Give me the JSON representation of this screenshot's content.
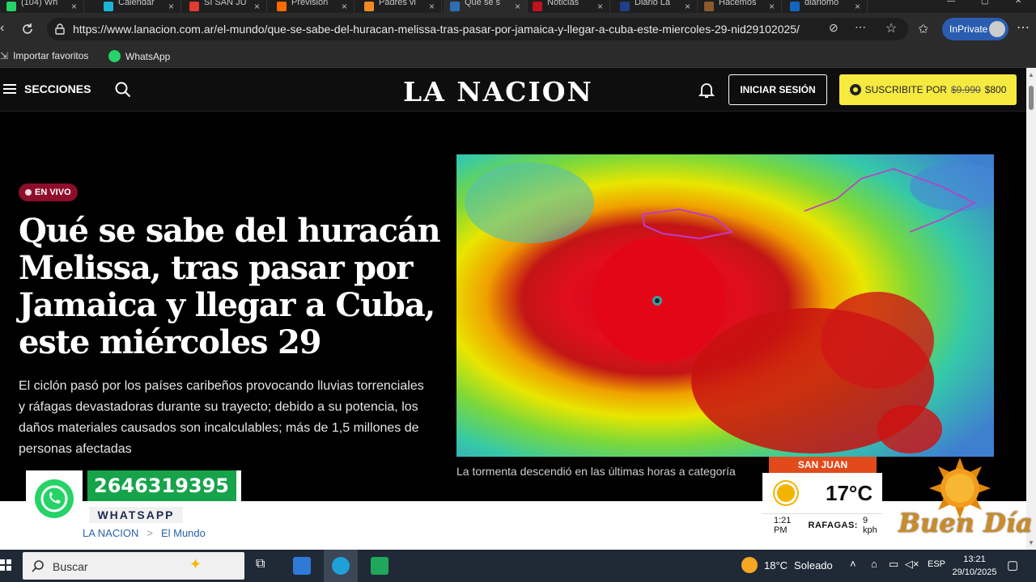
{
  "browser": {
    "tabs": [
      {
        "title": "(104) Wh",
        "favicon_color": "#25d366",
        "active": false
      },
      {
        "title": "Calendar",
        "favicon_color": "#19b3d6",
        "active": false
      },
      {
        "title": "SI SAN JU",
        "favicon_color": "#e23b2f",
        "active": false
      },
      {
        "title": "Previsión",
        "favicon_color": "#ff6a00",
        "active": false
      },
      {
        "title": "Padres vi",
        "favicon_color": "#f08a24",
        "active": false
      },
      {
        "title": "Qué se s",
        "favicon_color": "#2d6fb3",
        "active": true
      },
      {
        "title": "Noticias",
        "favicon_color": "#c1121f",
        "active": false
      },
      {
        "title": "Diario La",
        "favicon_color": "#1f3f8a",
        "active": false
      },
      {
        "title": "Hacemos",
        "favicon_color": "#8b5a2b",
        "active": false
      },
      {
        "title": "diariomo",
        "favicon_color": "#1565c0",
        "active": false
      }
    ],
    "url": "https://www.lanacion.com.ar/el-mundo/que-se-sabe-del-huracan-melissa-tras-pasar-por-jamaica-y-llegar-a-cuba-este-miercoles-29-nid29102025/",
    "inprivate_label": "InPrivate",
    "bookmarks": [
      {
        "label": "Importar favoritos",
        "icon": "import-icon"
      },
      {
        "label": "WhatsApp",
        "icon": "whatsapp-icon"
      }
    ]
  },
  "site": {
    "sections_label": "SECCIONES",
    "logo": "LA NACION",
    "login_label": "INICIAR SESIÓN",
    "subscribe_prefix": "SUSCRIBITE POR",
    "subscribe_old_price": "$9.990",
    "subscribe_new_price": "$800",
    "brand_color": "#f6e940"
  },
  "article": {
    "badge": "EN VIVO",
    "headline": "Qué se sabe del huracán Melissa, tras pasar por Jamaica y llegar a Cuba, este miércoles 29",
    "summary": "El ciclón pasó por los países caribeños provocando lluvias torrenciales y ráfagas devastadoras durante su trayecto; debido a su potencia, los daños materiales causados son incalculables; más de 1,5 millones de personas afectadas",
    "image_caption": "La tormenta descendió en las últimas horas a categoría",
    "breadcrumb": [
      "LA NACION",
      "El Mundo"
    ]
  },
  "overlay": {
    "whatsapp_number": "2646319395",
    "whatsapp_label": "WHATSAPP",
    "weather_city": "SAN JUAN",
    "weather_temp": "17°C",
    "weather_time": "1:21 PM",
    "weather_gust_label": "RAFAGAS:",
    "weather_gust_value": "9 kph",
    "greeting": "Buen Día"
  },
  "taskbar": {
    "search_placeholder": "Buscar",
    "tray_temp": "18°C",
    "tray_condition": "Soleado",
    "language": "ESP",
    "time": "13:21",
    "date": "29/10/2025"
  }
}
